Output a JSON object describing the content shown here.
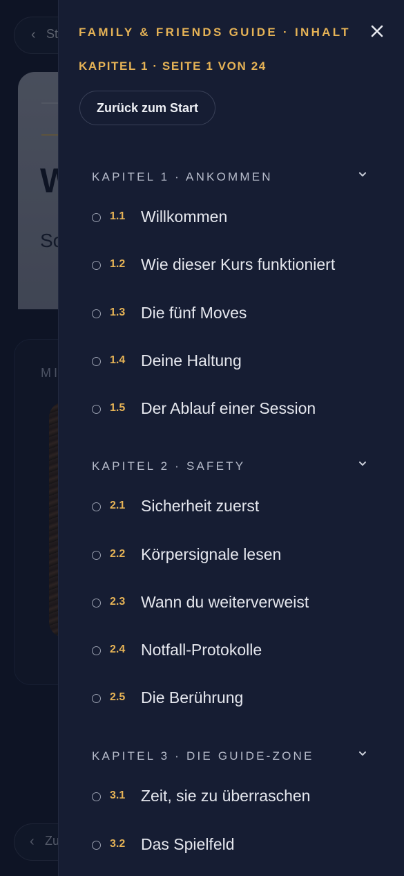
{
  "background": {
    "back_pill_label": "St",
    "bottom_pill_label": "Zu",
    "hero_heading": "W",
    "hero_sub": "Sc",
    "card_label": "MI"
  },
  "drawer": {
    "title": "FAMILY & FRIENDS GUIDE · INHALT",
    "close_icon": "×",
    "subtitle": "KAPITEL 1 · SEITE 1 VON 24",
    "back_to_start": "Zurück zum Start"
  },
  "chapters": [
    {
      "title": "KAPITEL 1 · ANKOMMEN",
      "expanded": true,
      "lessons": [
        {
          "num": "1.1",
          "title": "Willkommen"
        },
        {
          "num": "1.2",
          "title": "Wie dieser Kurs funktioniert"
        },
        {
          "num": "1.3",
          "title": "Die fünf Moves"
        },
        {
          "num": "1.4",
          "title": "Deine Haltung"
        },
        {
          "num": "1.5",
          "title": "Der Ablauf einer Session"
        }
      ]
    },
    {
      "title": "KAPITEL 2 · SAFETY",
      "expanded": true,
      "lessons": [
        {
          "num": "2.1",
          "title": "Sicherheit zuerst"
        },
        {
          "num": "2.2",
          "title": "Körpersignale lesen"
        },
        {
          "num": "2.3",
          "title": "Wann du weiterverweist"
        },
        {
          "num": "2.4",
          "title": "Notfall-Protokolle"
        },
        {
          "num": "2.5",
          "title": "Die Berührung"
        }
      ]
    },
    {
      "title": "KAPITEL 3 · DIE GUIDE-ZONE",
      "expanded": true,
      "lessons": [
        {
          "num": "3.1",
          "title": "Zeit, sie zu überraschen"
        },
        {
          "num": "3.2",
          "title": "Das Spielfeld"
        }
      ]
    }
  ],
  "colors": {
    "accent": "#e6b356",
    "drawer_bg": "#161d33",
    "text": "#e5e7ee",
    "muted": "#b7bccb"
  }
}
